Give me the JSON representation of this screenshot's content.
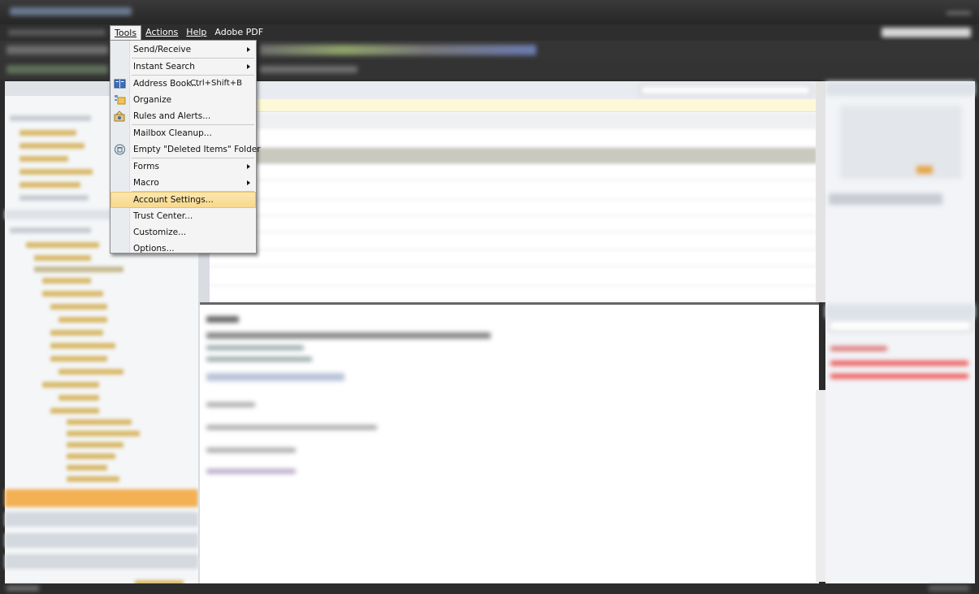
{
  "menubar": {
    "tools": "Tools",
    "actions": "Actions",
    "help": "Help",
    "adobe": "Adobe PDF"
  },
  "tools_menu": {
    "items": [
      {
        "label": "Send/Receive",
        "submenu": true
      },
      {
        "label": "Instant Search",
        "submenu": true
      },
      {
        "label": "Address Book...",
        "shortcut": "Ctrl+Shift+B",
        "icon": "address-book-icon"
      },
      {
        "label": "Organize",
        "icon": "organize-icon"
      },
      {
        "label": "Rules and Alerts...",
        "icon": "rules-icon"
      },
      {
        "label": "Mailbox Cleanup..."
      },
      {
        "label": "Empty \"Deleted Items\" Folder",
        "icon": "trash-icon"
      },
      {
        "label": "Forms",
        "submenu": true
      },
      {
        "label": "Macro",
        "submenu": true
      },
      {
        "label": "Account Settings...",
        "highlighted": true
      },
      {
        "label": "Trust Center..."
      },
      {
        "label": "Customize..."
      },
      {
        "label": "Options..."
      }
    ]
  },
  "colors": {
    "highlight": "#f8d88a",
    "menu_bg": "#f4f4f4",
    "chrome": "#2b2b2b"
  }
}
